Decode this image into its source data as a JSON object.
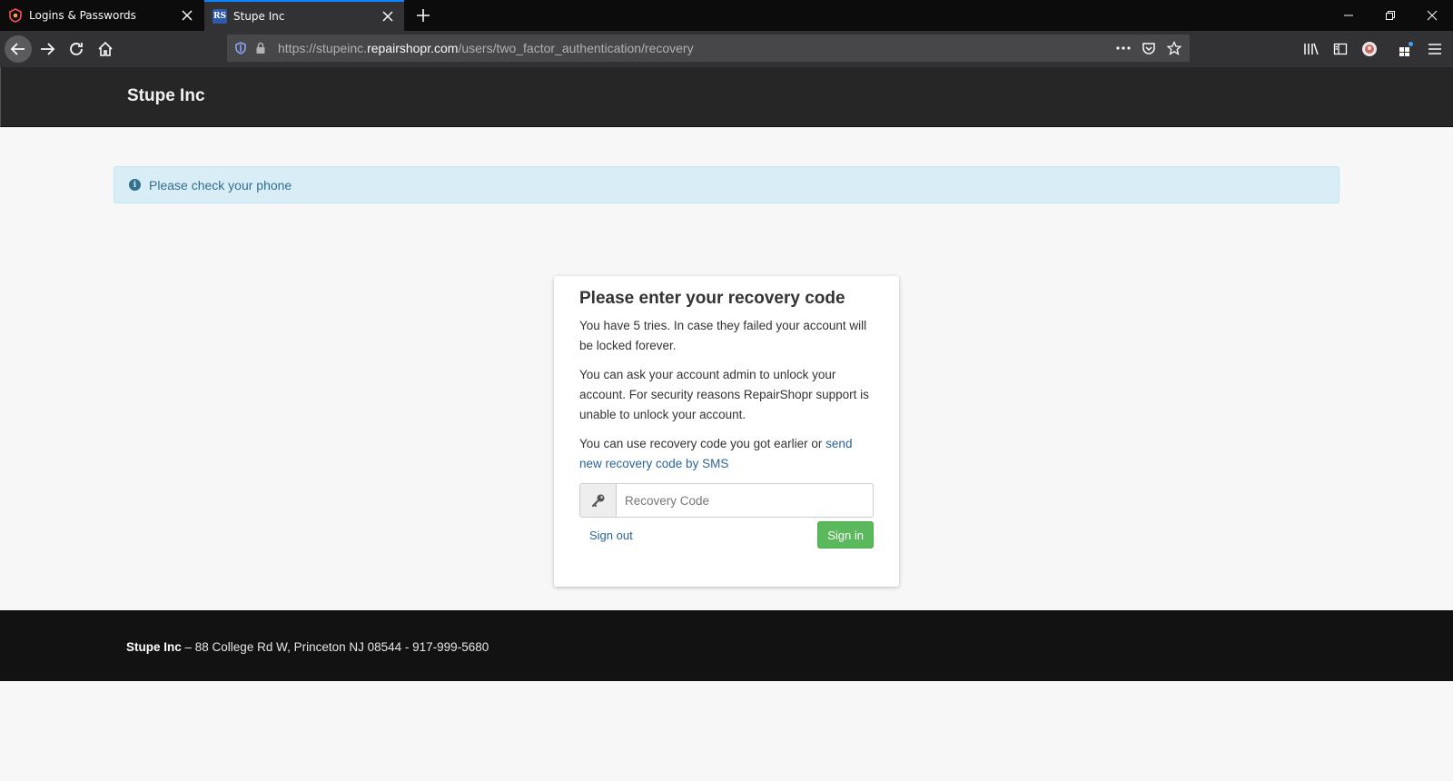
{
  "browser": {
    "tabs": [
      {
        "title": "Logins & Passwords",
        "icon": "lockwise-icon"
      },
      {
        "title": "Stupe Inc",
        "icon": "rs-favicon",
        "favicon_text": "RS",
        "active": true
      }
    ],
    "url": {
      "prefix": "https://stupeinc.",
      "host": "repairshopr.com",
      "path": "/users/two_factor_authentication/recovery"
    }
  },
  "header": {
    "brand": "Stupe Inc"
  },
  "alert": {
    "message": "Please check your phone",
    "icon": "info-icon"
  },
  "card": {
    "title": "Please enter your recovery code",
    "para1": "You have 5 tries. In case they failed your account will be locked forever.",
    "para2": "You can ask your account admin to unlock your account. For security reasons RepairShopr support is unable to unlock your account.",
    "para3_text": "You can use recovery code you got earlier or ",
    "para3_link": "send new recovery code by SMS",
    "input_placeholder": "Recovery Code",
    "signout_label": "Sign out",
    "signin_label": "Sign in"
  },
  "footer": {
    "company": "Stupe Inc",
    "address": " – 88 College Rd W, Princeton NJ 08544 - 917-999-5680"
  },
  "colors": {
    "alert_bg": "#d9edf7",
    "alert_text": "#31708f",
    "signin_bg": "#5cb85c",
    "link": "#2a6496",
    "header_bg": "#262626",
    "footer_bg": "#121212"
  }
}
